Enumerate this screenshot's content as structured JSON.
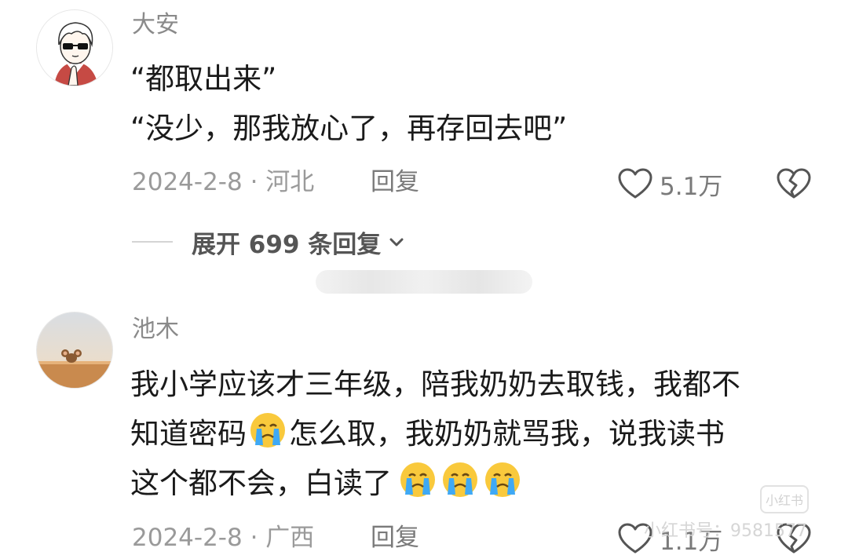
{
  "comments": [
    {
      "author": "大安",
      "lines": [
        "“都取出来”",
        "“没少，那我放心了，再存回去吧”"
      ],
      "date_location": "2024-2-8 · 河北",
      "reply_label": "回复",
      "like_count": "5.1万"
    },
    {
      "author": "池木",
      "lines": [
        "我小学应该才三年级，陪我奶奶去取钱，我都不",
        "知道密码",
        "怎么取，我奶奶就骂我，说我读书",
        "这个都不会，白读了"
      ],
      "date_location": "2024-2-8 · 广西",
      "reply_label": "回复",
      "like_count": "1.1万"
    }
  ],
  "expand_replies": {
    "label": "展开 699 条回复"
  },
  "watermark": {
    "badge": "小红书",
    "id_text": "小红书号：9581577"
  },
  "icons": [
    "heart-outline-icon",
    "broken-heart-icon",
    "chevron-down-icon",
    "crying-emoji-icon"
  ],
  "colors": {
    "text_primary": "#1a1a1a",
    "text_secondary": "#8a8a8a",
    "emoji_yellow": "#f9c93c",
    "tear_blue": "#3fa9f5"
  }
}
